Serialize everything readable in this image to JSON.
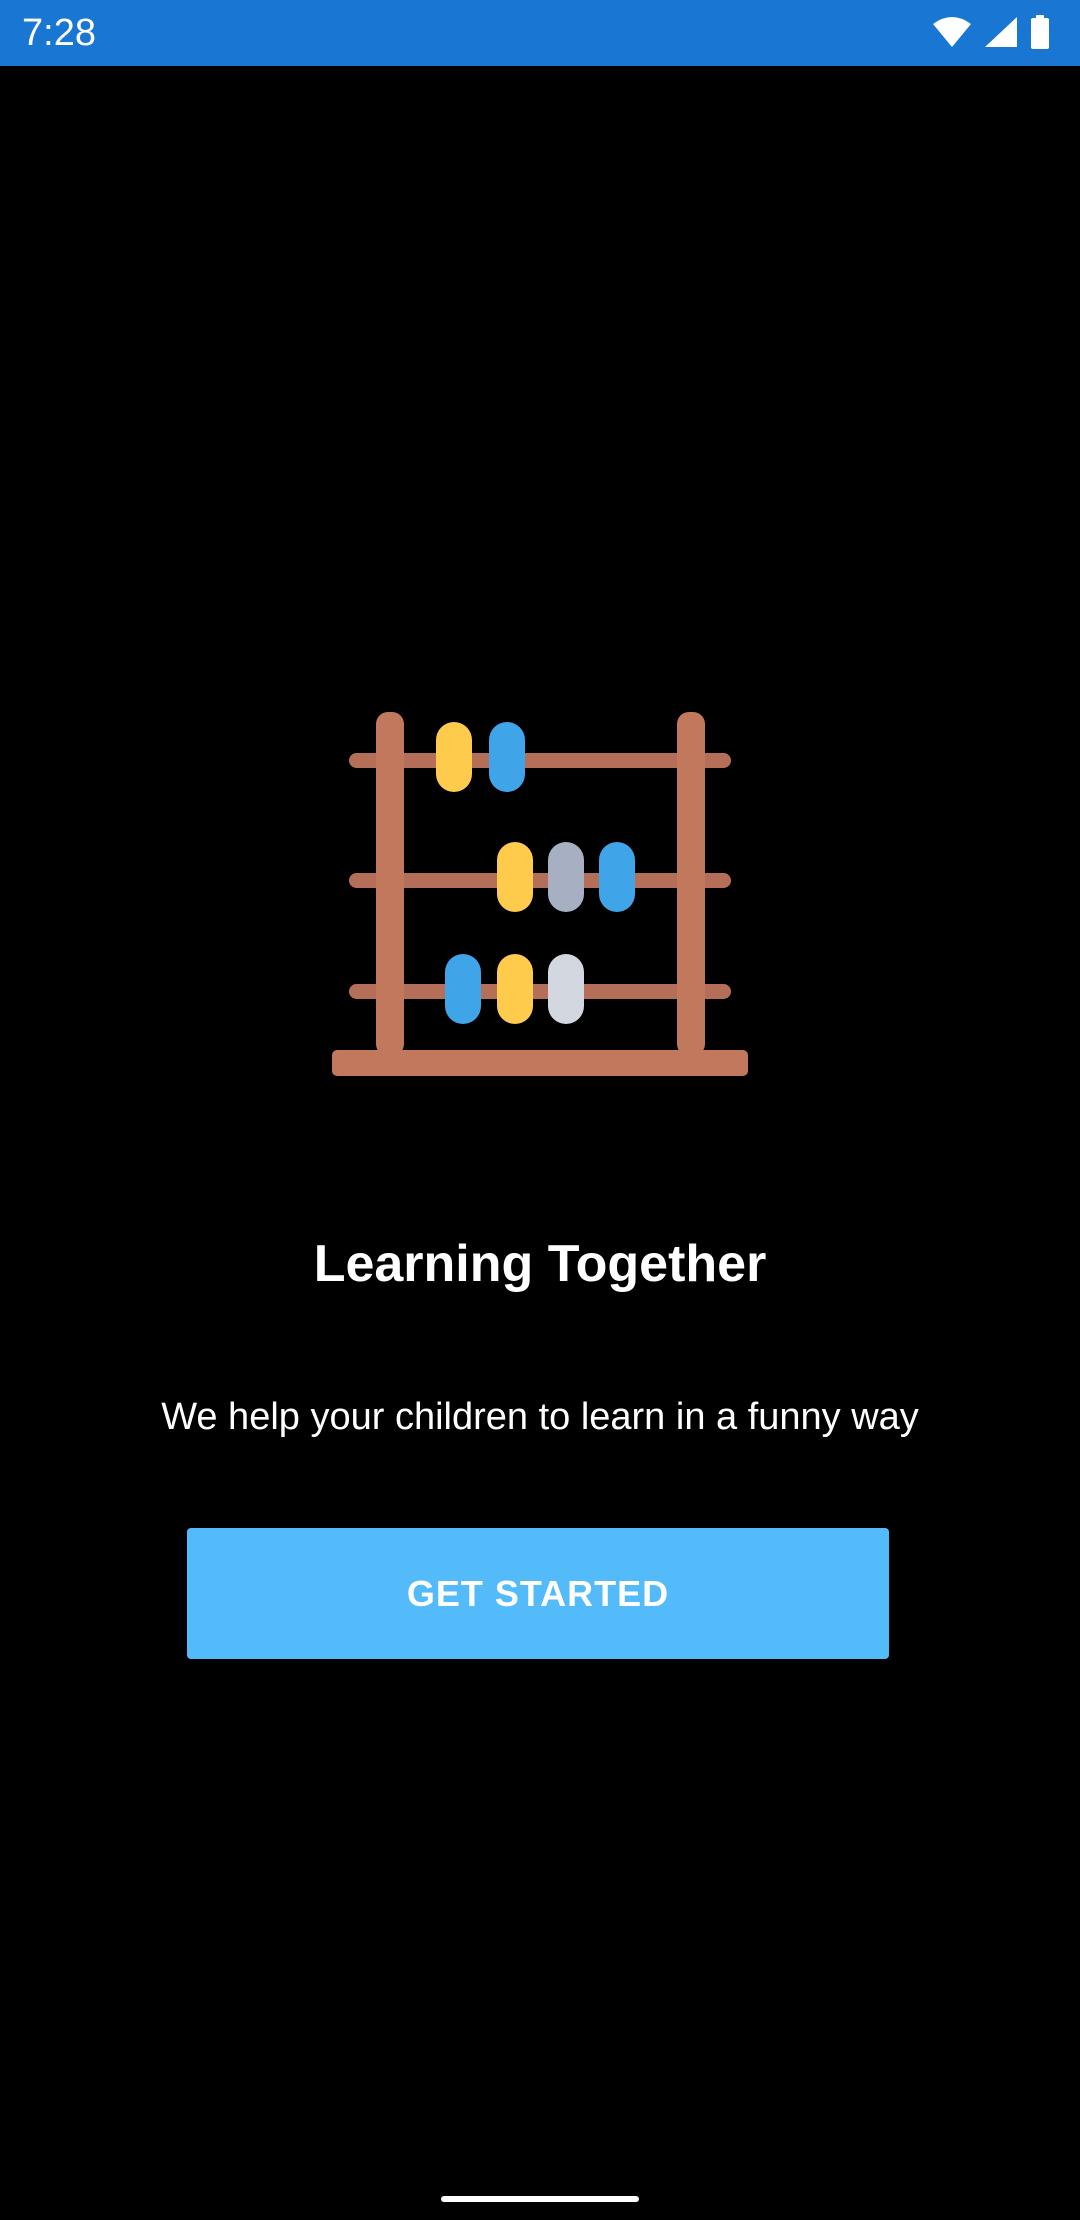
{
  "status_bar": {
    "time": "7:28",
    "color": "#1976D2",
    "icons": [
      "wifi-icon",
      "cell-signal-icon",
      "battery-icon"
    ]
  },
  "illustration": {
    "icon": "abacus-icon",
    "frame_color": "#C2785D",
    "bead_colors": [
      "#FFCB4C",
      "#3FA4E8",
      "#A6B0C2",
      "#D3D8E0"
    ]
  },
  "onboarding": {
    "title": "Learning Together",
    "subtitle": "We help your children to learn in a funny way",
    "button_label": "GET STARTED",
    "button_color": "#54BBFB"
  },
  "theme": {
    "background": "#000000",
    "text": "#FFFFFF"
  }
}
